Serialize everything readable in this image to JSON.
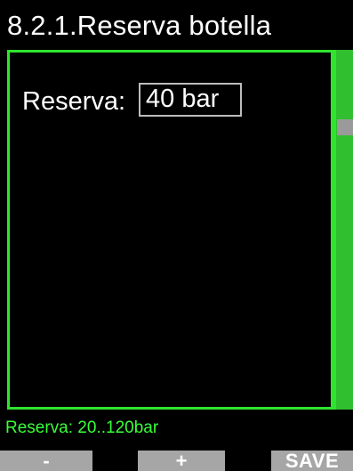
{
  "header": {
    "title": "8.2.1.Reserva botella"
  },
  "setting": {
    "label": "Reserva:",
    "value": "40 bar"
  },
  "footer": {
    "range_text": "Reserva: 20..120bar"
  },
  "softkeys": {
    "minus_label": "-",
    "plus_label": "+",
    "save_label": "SAVE"
  },
  "colors": {
    "accent_green": "#2fe32f",
    "softkey_gray": "#a6a6a6",
    "background": "#000000"
  }
}
